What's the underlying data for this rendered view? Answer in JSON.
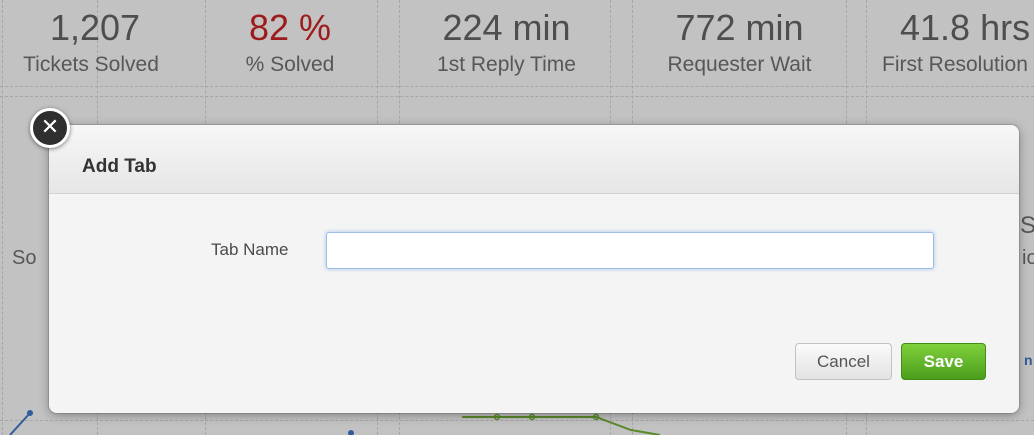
{
  "dashboard": {
    "metrics": [
      {
        "value": "1,207",
        "label": "Tickets Solved",
        "alert": false
      },
      {
        "value": "82 %",
        "label": "% Solved",
        "alert": true
      },
      {
        "value": "224 min",
        "label": "1st Reply Time",
        "alert": false
      },
      {
        "value": "772 min",
        "label": "Requester Wait",
        "alert": false
      },
      {
        "value": "41.8 hrs",
        "label": "First Resolution",
        "alert": false
      }
    ],
    "partial_left": "So",
    "partial_right_1": "S",
    "partial_right_2": "io",
    "partial_right_3": "n",
    "colors": {
      "alert": "#9e1b1b",
      "chart_line": "#5a8a2a",
      "chart_line_alt": "#2f5d9c"
    }
  },
  "modal": {
    "title": "Add Tab",
    "close_icon": "close-icon",
    "field": {
      "label": "Tab Name",
      "value": "",
      "placeholder": ""
    },
    "buttons": {
      "cancel_label": "Cancel",
      "save_label": "Save"
    },
    "colors": {
      "save_button": "#5cb82a",
      "input_focus_border": "#9dbde7"
    }
  }
}
